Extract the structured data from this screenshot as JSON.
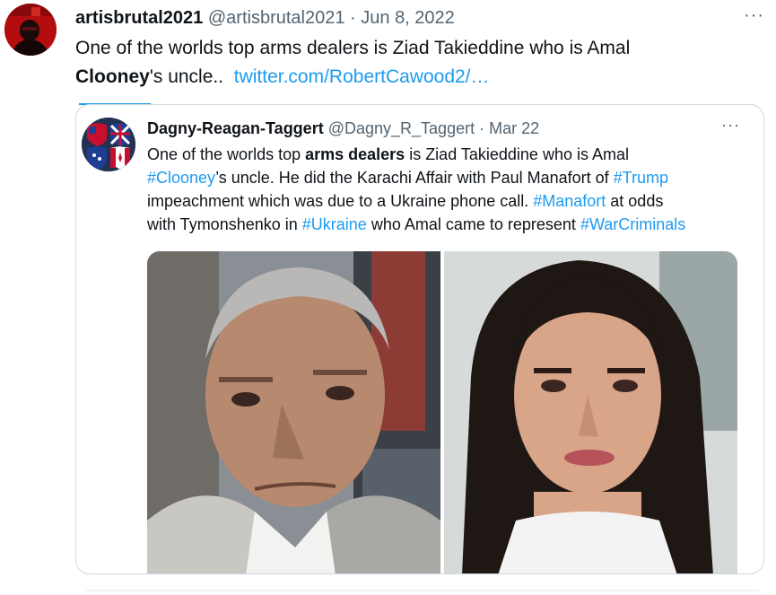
{
  "tweet": {
    "display_name": "artisbrutal2021",
    "handle": "@artisbrutal2021",
    "separator": "·",
    "date": "Jun 8, 2022",
    "more_label": "···",
    "text_part1": "One of the worlds top arms dealers is Ziad Takieddine who is Amal",
    "text_bold": "Clooney",
    "text_part2": "'s uncle..",
    "link_text": "twitter.com/RobertCawood2/…"
  },
  "quote": {
    "display_name": "Dagny-Reagan-Taggert",
    "handle": "@Dagny_R_Taggert",
    "separator": "·",
    "date": "Mar 22",
    "more_label": "···",
    "t1": "One of the worlds top ",
    "t1_bold": "arms dealers",
    "t2": " is Ziad Takieddine who is Amal",
    "hashtag_clooney": "#Clooney",
    "t3": "’s uncle.  He did the Karachi Affair with Paul Manafort of ",
    "hashtag_trump": "#Trump",
    "t4": "impeachment which was due to a Ukraine phone call. ",
    "hashtag_manafort": "#Manafort",
    "t5": " at odds",
    "t6": "with Tymonshenko in ",
    "hashtag_ukraine": "#Ukraine",
    "t7": " who Amal came to represent ",
    "hashtag_warcriminals": "#WarCriminals"
  },
  "colors": {
    "link": "#1d9bf0",
    "muted": "#536471",
    "text": "#0f1419",
    "border": "#cfd9de"
  }
}
